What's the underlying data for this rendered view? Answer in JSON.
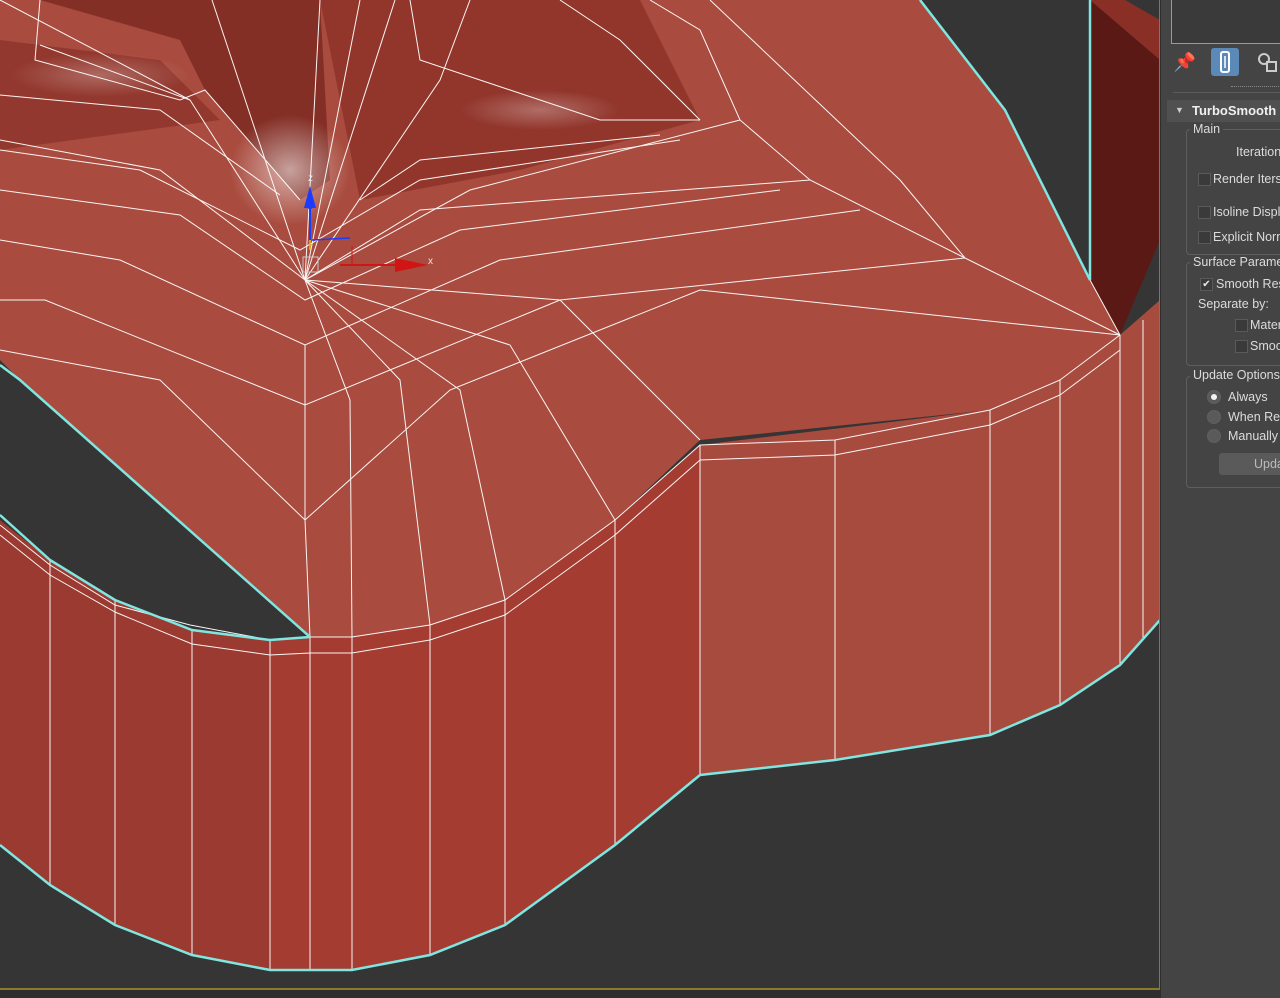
{
  "viewport": {
    "object_color": "#a84b3e",
    "wire_color": "#ffffff",
    "selection_outline_color": "#7fe6e0",
    "background_color": "#353535",
    "gizmo": {
      "z_label": "z",
      "x_label": "x"
    }
  },
  "panel": {
    "tabs": {
      "pin": "pin-icon",
      "modify": "modify-tab-icon",
      "configure": "configure-icon"
    },
    "rollout_title": "TurboSmooth",
    "main_group": {
      "label": "Main",
      "iterations_label": "Iteration",
      "render_iters_label": "Render Iters",
      "isoline_label": "Isoline Displ",
      "explicit_normals_label": "Explicit Norn"
    },
    "surface_group": {
      "label": "Surface Paramete",
      "smooth_result_label": "Smooth Res",
      "smooth_result_checked": true,
      "separate_by_label": "Separate by:",
      "materials_label": "Mater",
      "smoothing_label": "Smoo"
    },
    "update_group": {
      "label": "Update Options",
      "always_label": "Always",
      "when_rendering_label": "When Ren",
      "manually_label": "Manually",
      "selected": "Always",
      "update_button_label": "Upda"
    }
  }
}
